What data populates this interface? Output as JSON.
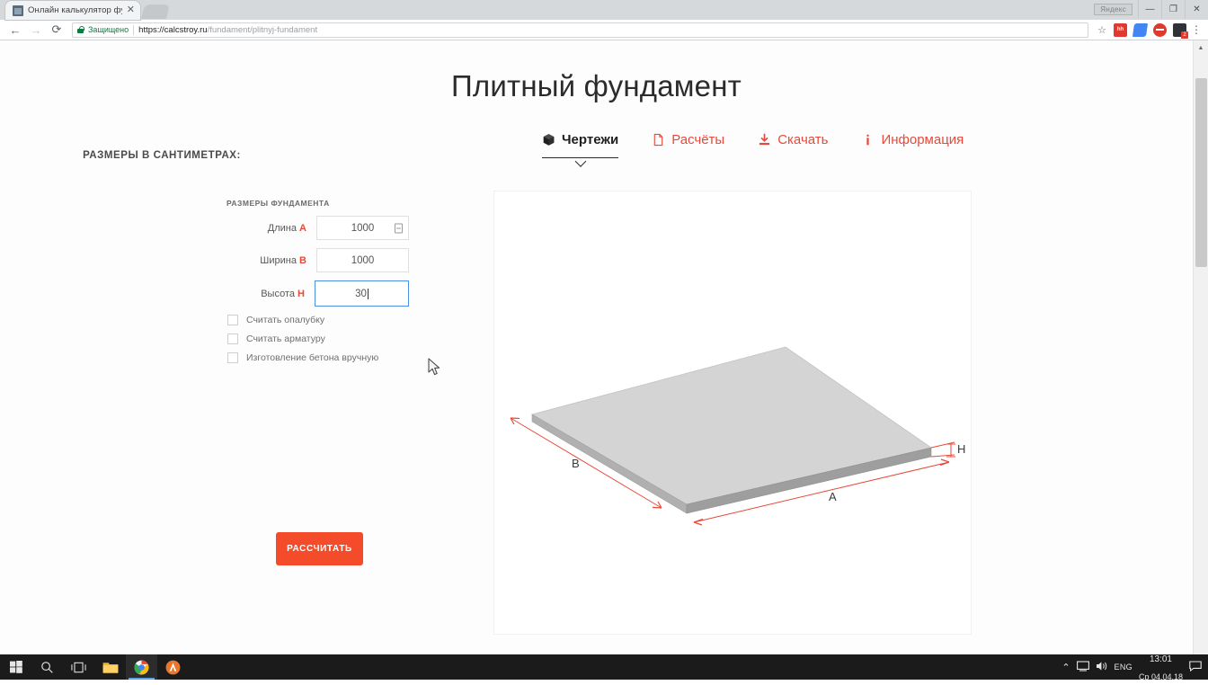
{
  "browser": {
    "tab": {
      "title": "Онлайн калькулятор фу",
      "close_label": "✕",
      "favicon_name": "site-favicon"
    },
    "window_note": "Яндекс",
    "minimize": "—",
    "maximize": "❐",
    "close": "✕",
    "nav": {
      "back": "←",
      "forward": "→",
      "reload": "⟳"
    },
    "omnibox": {
      "secure_text": "Защищено",
      "url_domain": "https://calcstroy.ru",
      "url_path": "/fundament/plitnyj-fundament",
      "star": "☆"
    },
    "menu": "⋮",
    "extensions": [
      "hh-extension",
      "translate-extension",
      "adblock-extension",
      "downloads-extension"
    ]
  },
  "page": {
    "title": "Плитный фундамент",
    "units_title": "РАЗМЕРЫ В САНТИМЕТРАХ:",
    "section_label": "РАЗМЕРЫ ФУНДАМЕНТА",
    "fields": [
      {
        "label": "Длина",
        "dim": "A",
        "value": "1000",
        "focused": false,
        "has_spinner": true
      },
      {
        "label": "Ширина",
        "dim": "B",
        "value": "1000",
        "focused": false,
        "has_spinner": false
      },
      {
        "label": "Высота",
        "dim": "H",
        "value": "30",
        "focused": true,
        "has_spinner": false
      }
    ],
    "checkboxes": [
      {
        "label": "Считать опалубку",
        "checked": false
      },
      {
        "label": "Считать арматуру",
        "checked": false
      },
      {
        "label": "Изготовление бетона вручную",
        "checked": false
      }
    ],
    "calculate_button": "РАССЧИТАТЬ",
    "tabs": [
      {
        "label": "Чертежи",
        "icon": "cube-icon",
        "active": true
      },
      {
        "label": "Расчёты",
        "icon": "document-icon",
        "active": false
      },
      {
        "label": "Скачать",
        "icon": "download-icon",
        "active": false
      },
      {
        "label": "Информация",
        "icon": "info-icon",
        "active": false
      }
    ],
    "drawing": {
      "labels": {
        "length": "A",
        "width": "B",
        "height": "H"
      },
      "accent_color": "#e8493a",
      "top_face_color": "#d4d4d4",
      "front_face_color": "#9e9e9e",
      "side_face_color": "#bdbdbd"
    }
  },
  "taskbar": {
    "start": "start-icon",
    "search": "search-icon",
    "taskview": "task-view-icon",
    "explorer": "file-explorer-icon",
    "chrome": "chrome-icon",
    "app": "autocad-icon",
    "tray_up": "⌃",
    "network": "network-icon",
    "volume": "volume-icon",
    "language": "ENG",
    "time": "13:01",
    "date": "Ср 04.04.18",
    "notifications": "notification-icon"
  },
  "theme": {
    "accent": "#e8493a",
    "button": "#f44b2a",
    "text_dark": "#2b2b2b",
    "text_muted": "#6f6f6f"
  }
}
